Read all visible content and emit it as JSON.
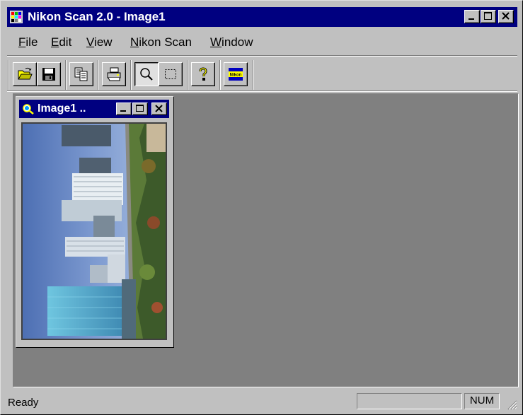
{
  "window": {
    "title": "Nikon Scan 2.0 - Image1"
  },
  "menu": {
    "items": [
      {
        "label": "File",
        "accel": "F",
        "rest": "ile"
      },
      {
        "label": "Edit",
        "accel": "E",
        "rest": "dit"
      },
      {
        "label": "View",
        "accel": "V",
        "rest": "iew"
      },
      {
        "label": "Nikon Scan",
        "accel": "N",
        "rest": "ikon Scan"
      },
      {
        "label": "Window",
        "accel": "W",
        "rest": "indow"
      }
    ]
  },
  "toolbar": {
    "buttons": [
      {
        "name": "open-icon"
      },
      {
        "name": "save-icon"
      },
      {
        "name": "copy-icon"
      },
      {
        "name": "print-icon"
      },
      {
        "name": "zoom-icon",
        "pressed": true
      },
      {
        "name": "marquee-select-icon"
      },
      {
        "name": "help-icon"
      },
      {
        "name": "nikon-logo-icon"
      }
    ]
  },
  "child_window": {
    "title": "Image1 .."
  },
  "status": {
    "text": "Ready",
    "num": "NUM"
  },
  "colors": {
    "title_bar": "#000080",
    "face": "#c0c0c0",
    "workspace": "#808080"
  }
}
